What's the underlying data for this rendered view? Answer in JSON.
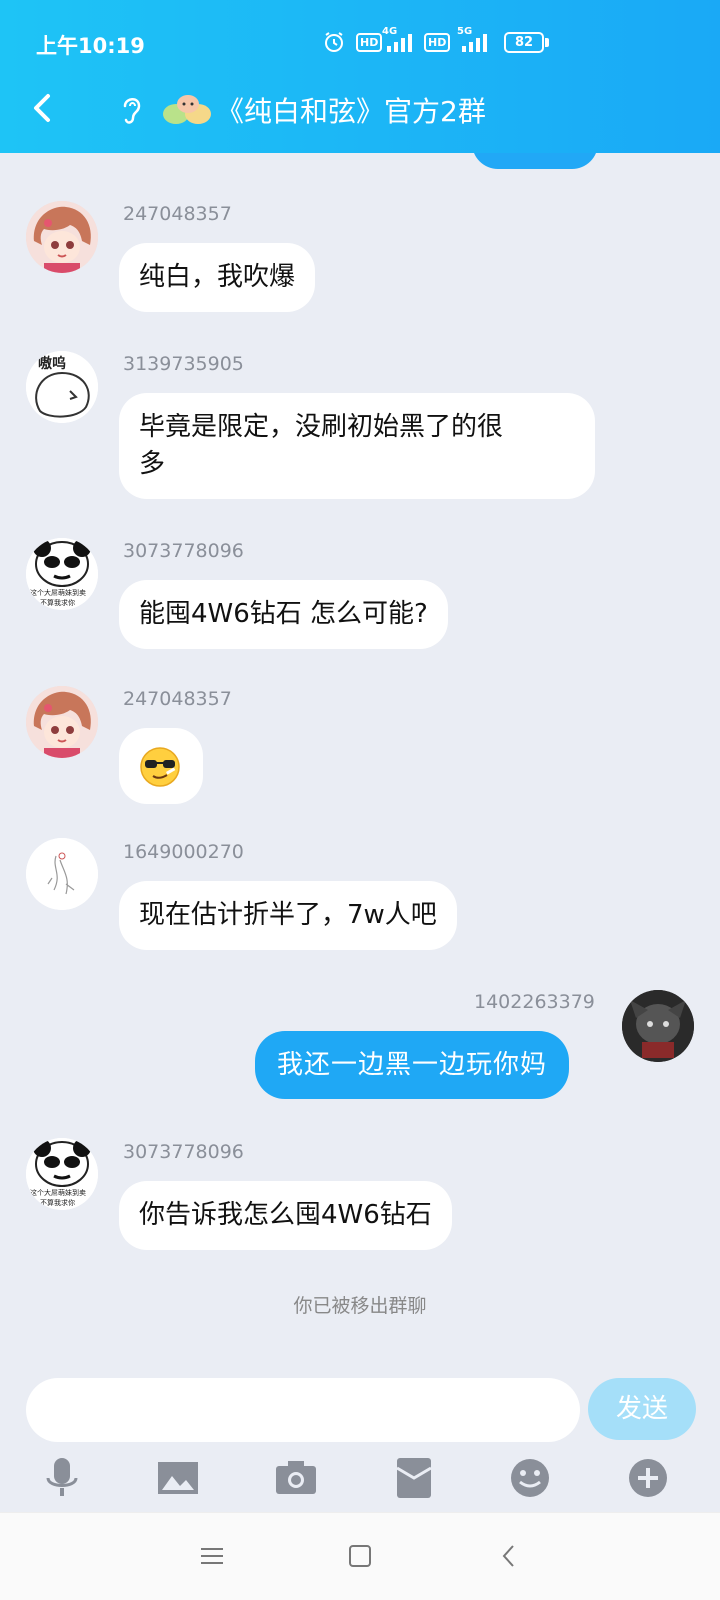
{
  "status_bar": {
    "time": "上午10:19",
    "hd1": "HD",
    "net1": "4G",
    "hd2": "HD",
    "net2": "5G",
    "battery": "82"
  },
  "header": {
    "title": "《纯白和弦》官方2群"
  },
  "messages": [
    {
      "sender": "247048357",
      "text": "纯白，我吹爆"
    },
    {
      "sender": "3139735905",
      "text_line1": "毕竟是限定，没刷初始黑了的很",
      "text_line2": "多"
    },
    {
      "sender": "3073778096",
      "text": "能囤4W6钻石 怎么可能?"
    },
    {
      "sender": "247048357",
      "emoji": "😎"
    },
    {
      "sender": "1649000270",
      "text": "现在估计折半了，7w人吧"
    },
    {
      "sender": "1402263379",
      "text": "我还一边黑一边玩你妈"
    },
    {
      "sender": "3073778096",
      "text": "你告诉我怎么囤4W6钻石"
    }
  ],
  "system_note": "你已被移出群聊",
  "input": {
    "placeholder": "",
    "send_label": "发送"
  },
  "avatars": {
    "a2_text": "嗷呜",
    "a3_caption1": "这个大屌萌妹到卖",
    "a3_caption2": "不算我求你"
  },
  "colors": {
    "header": "#1ec4f6",
    "outgoing_bubble": "#1fa8f5",
    "send_button": "#a5dff9",
    "background": "#eaedf4"
  }
}
